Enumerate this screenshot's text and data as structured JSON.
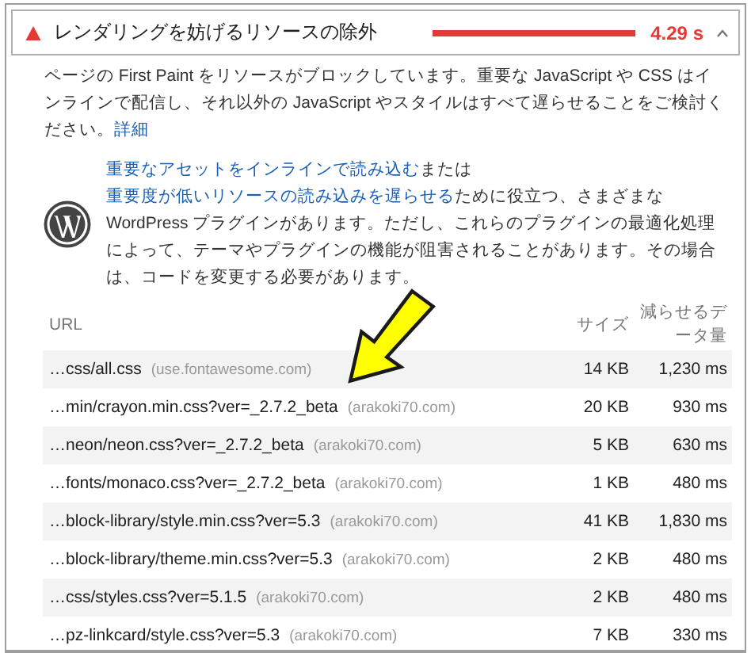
{
  "audit": {
    "title": "レンダリングを妨げるリソースの除外",
    "value": "4.29 s",
    "expanded": true
  },
  "description": [
    {
      "kind": "text",
      "text": "ページの First Paint をリソースがブロックしています。重要な JavaScript や CSS はインラインで配信し、それ以外の JavaScript やスタイルはすべて遅らせることをご検討ください。"
    },
    {
      "kind": "link",
      "text": "詳細"
    }
  ],
  "stack_pack": [
    {
      "kind": "link",
      "text": "重要なアセットをインラインで読み込む"
    },
    {
      "kind": "text",
      "text": "または"
    },
    {
      "kind": "link",
      "text": "重要度が低いリソースの読み込みを遅らせる"
    },
    {
      "kind": "text",
      "text": "ために役立つ、さまざまな WordPress プラグインがあります。ただし、これらのプラグインの最適化処理によって、テーマやプラグインの機能が阻害されることがあります。その場合は、コードを変更する必要があります。"
    }
  ],
  "table": {
    "columns": [
      "URL",
      "サイズ",
      "減らせるデータ量"
    ],
    "rows": [
      {
        "url": "…css/all.css",
        "host": "(use.fontawesome.com)",
        "size": "14 KB",
        "savings": "1,230 ms"
      },
      {
        "url": "…min/crayon.min.css?ver=_2.7.2_beta",
        "host": "(arakoki70.com)",
        "size": "20 KB",
        "savings": "930 ms"
      },
      {
        "url": "…neon/neon.css?ver=_2.7.2_beta",
        "host": "(arakoki70.com)",
        "size": "5 KB",
        "savings": "630 ms"
      },
      {
        "url": "…fonts/monaco.css?ver=_2.7.2_beta",
        "host": "(arakoki70.com)",
        "size": "1 KB",
        "savings": "480 ms"
      },
      {
        "url": "…block-library/style.min.css?ver=5.3",
        "host": "(arakoki70.com)",
        "size": "41 KB",
        "savings": "1,830 ms"
      },
      {
        "url": "…block-library/theme.min.css?ver=5.3",
        "host": "(arakoki70.com)",
        "size": "2 KB",
        "savings": "480 ms"
      },
      {
        "url": "…css/styles.css?ver=5.1.5",
        "host": "(arakoki70.com)",
        "size": "2 KB",
        "savings": "480 ms"
      },
      {
        "url": "…pz-linkcard/style.css?ver=5.3",
        "host": "(arakoki70.com)",
        "size": "7 KB",
        "savings": "330 ms"
      }
    ]
  }
}
